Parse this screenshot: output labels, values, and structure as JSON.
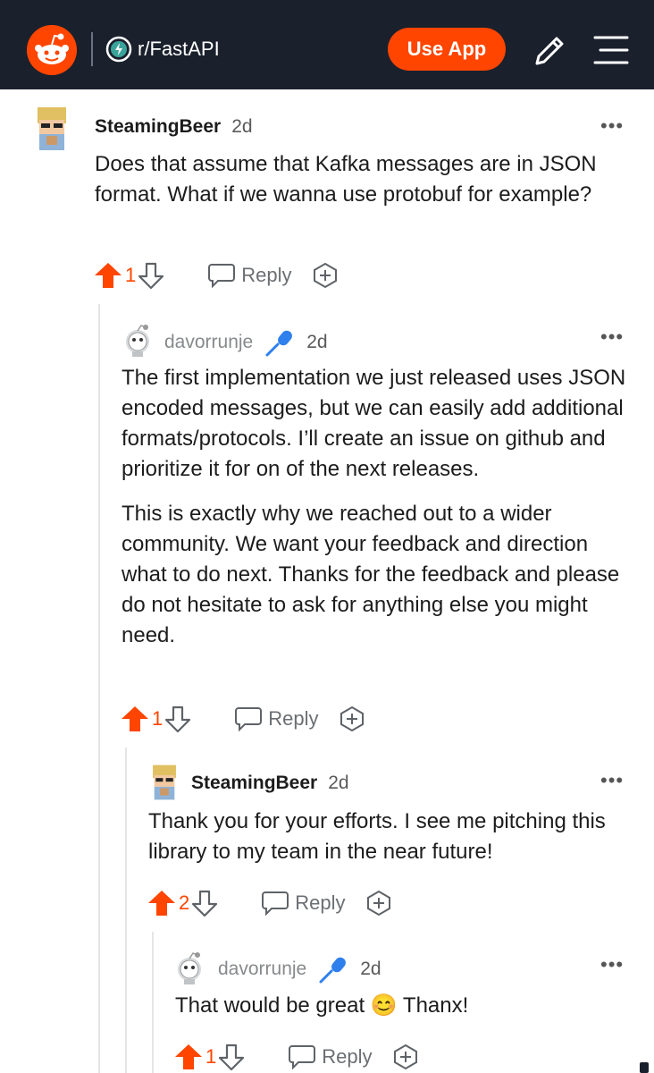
{
  "header": {
    "subreddit": "r/FastAPI",
    "use_app": "Use App",
    "brand_color": "#ff4500",
    "bar_color": "#1a202c"
  },
  "comments": [
    {
      "author": "SteamingBeer",
      "age": "2d",
      "paragraphs": [
        "Does that assume that Kafka messages are in JSON format. What if we wanna use protobuf for example?"
      ],
      "score": "1",
      "reply_label": "Reply",
      "more": "•••"
    },
    {
      "author": "davorrunje",
      "age": "2d",
      "paragraphs": [
        "The first implementation we just released uses JSON encoded messages, but we can easily add additional formats/protocols. I’ll create an issue on github and prioritize it for on of the next releases.",
        "This is exactly why we reached out to a wider community. We want your feedback and direction what to do next. Thanks for the feedback and please do not hesitate to ask for anything else you might need."
      ],
      "score": "1",
      "reply_label": "Reply",
      "more": "•••"
    },
    {
      "author": "SteamingBeer",
      "age": "2d",
      "paragraphs": [
        "Thank you for your efforts. I see me pitching this library to my team in the near future!"
      ],
      "score": "2",
      "reply_label": "Reply",
      "more": "•••"
    },
    {
      "author": "davorrunje",
      "age": "2d",
      "paragraphs": [
        "That would be great 😊 Thanx!"
      ],
      "score": "1",
      "reply_label": "Reply",
      "more": "•••"
    }
  ],
  "icons": {
    "logo": "reddit-logo-icon",
    "subreddit": "subreddit-bolt-icon",
    "edit": "pencil-icon",
    "menu": "hamburger-icon",
    "upvote": "upvote-arrow-icon",
    "downvote": "downvote-arrow-icon",
    "reply": "speech-bubble-icon",
    "award": "award-icon",
    "flair": "microphone-icon"
  }
}
